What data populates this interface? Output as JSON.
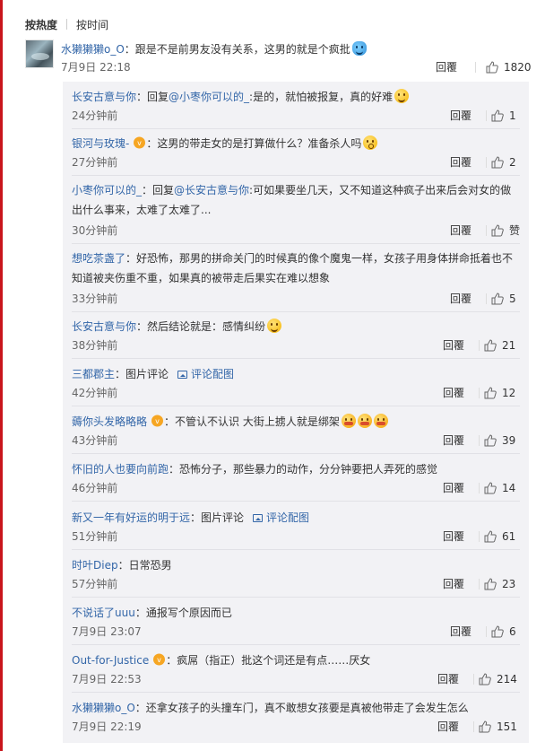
{
  "tabs": [
    {
      "label": "按热度",
      "active": true
    },
    {
      "label": "按时间",
      "active": false
    }
  ],
  "top_comment": {
    "user": "水獭獭獭o_O",
    "text": "：跟是不是前男友没有关系，这男的就是个疯批",
    "emoji": "blue-face-emoji",
    "time": "7月9日 22:18",
    "reply_label": "回覆",
    "likes": "1820"
  },
  "replies": [
    {
      "user": "长安古意与你",
      "text": "：回复",
      "mention": "@小枣你可以的_",
      "text2": ":是的，就怕被报复，真的好难",
      "emoji": "smile-emoji",
      "time": "24分钟前",
      "reply_label": "回覆",
      "likes": "1",
      "vip": false
    },
    {
      "user": "银河与玫瑰-",
      "text": "：这男的带走女的是打算做什么？准备杀人吗",
      "emoji": "shock-emoji",
      "time": "27分钟前",
      "reply_label": "回覆",
      "likes": "2",
      "vip": true
    },
    {
      "user": "小枣你可以的_",
      "text": "：回复",
      "mention": "@长安古意与你",
      "text2": ":可如果要坐几天，又不知道这种疯子出来后会对女的做出什么事来，太难了太难了...",
      "time": "30分钟前",
      "reply_label": "回覆",
      "likes": "赞",
      "vip": false
    },
    {
      "user": "想吃茶盏了",
      "text": "：好恐怖，那男的拼命关门的时候真的像个魔鬼一样，女孩子用身体拼命抵着也不知道被夹伤重不重，如果真的被带走后果实在难以想象",
      "time": "33分钟前",
      "reply_label": "回覆",
      "likes": "5",
      "vip": false
    },
    {
      "user": "长安古意与你",
      "text": "：然后结论就是：感情纠纷",
      "emoji": "smile-emoji",
      "time": "38分钟前",
      "reply_label": "回覆",
      "likes": "21",
      "vip": false
    },
    {
      "user": "三都郡主",
      "text": "：图片评论",
      "pic_link": "评论配图",
      "time": "42分钟前",
      "reply_label": "回覆",
      "likes": "12",
      "vip": false
    },
    {
      "user": "薅你头发略略略",
      "text": "：不管认不认识  大街上掳人就是绑架",
      "emoji": "cry-emoji",
      "emoji_count": 3,
      "time": "43分钟前",
      "reply_label": "回覆",
      "likes": "39",
      "vip": true
    },
    {
      "user": "怀旧的人也要向前跑",
      "text": "：恐怖分子，那些暴力的动作，分分钟要把人弄死的感觉",
      "time": "46分钟前",
      "reply_label": "回覆",
      "likes": "14",
      "vip": false
    },
    {
      "user": "新又一年有好运的明于远",
      "text": "：图片评论",
      "pic_link": "评论配图",
      "time": "51分钟前",
      "reply_label": "回覆",
      "likes": "61",
      "vip": false
    },
    {
      "user": "时叶Diep",
      "text": "：日常恐男",
      "time": "57分钟前",
      "reply_label": "回覆",
      "likes": "23",
      "vip": false
    },
    {
      "user": "不说话了uuu",
      "text": "：通报写个原因而已",
      "time": "7月9日 23:07",
      "reply_label": "回覆",
      "likes": "6",
      "vip": false
    },
    {
      "user": "Out-for-Justice",
      "text": "：疯屌（指正）批这个词还是有点……厌女",
      "time": "7月9日 22:53",
      "reply_label": "回覆",
      "likes": "214",
      "vip": true
    },
    {
      "user": "水獭獭獭o_O",
      "text": "：还拿女孩子的头撞车门，真不敢想女孩要是真被他带走了会发生怎么",
      "time": "7月9日 22:19",
      "reply_label": "回覆",
      "likes": "151",
      "vip": false
    }
  ],
  "colors": {
    "accent_red": "#c9161c",
    "link_blue": "#3366a8",
    "reply_bg": "#f2f2f5"
  }
}
